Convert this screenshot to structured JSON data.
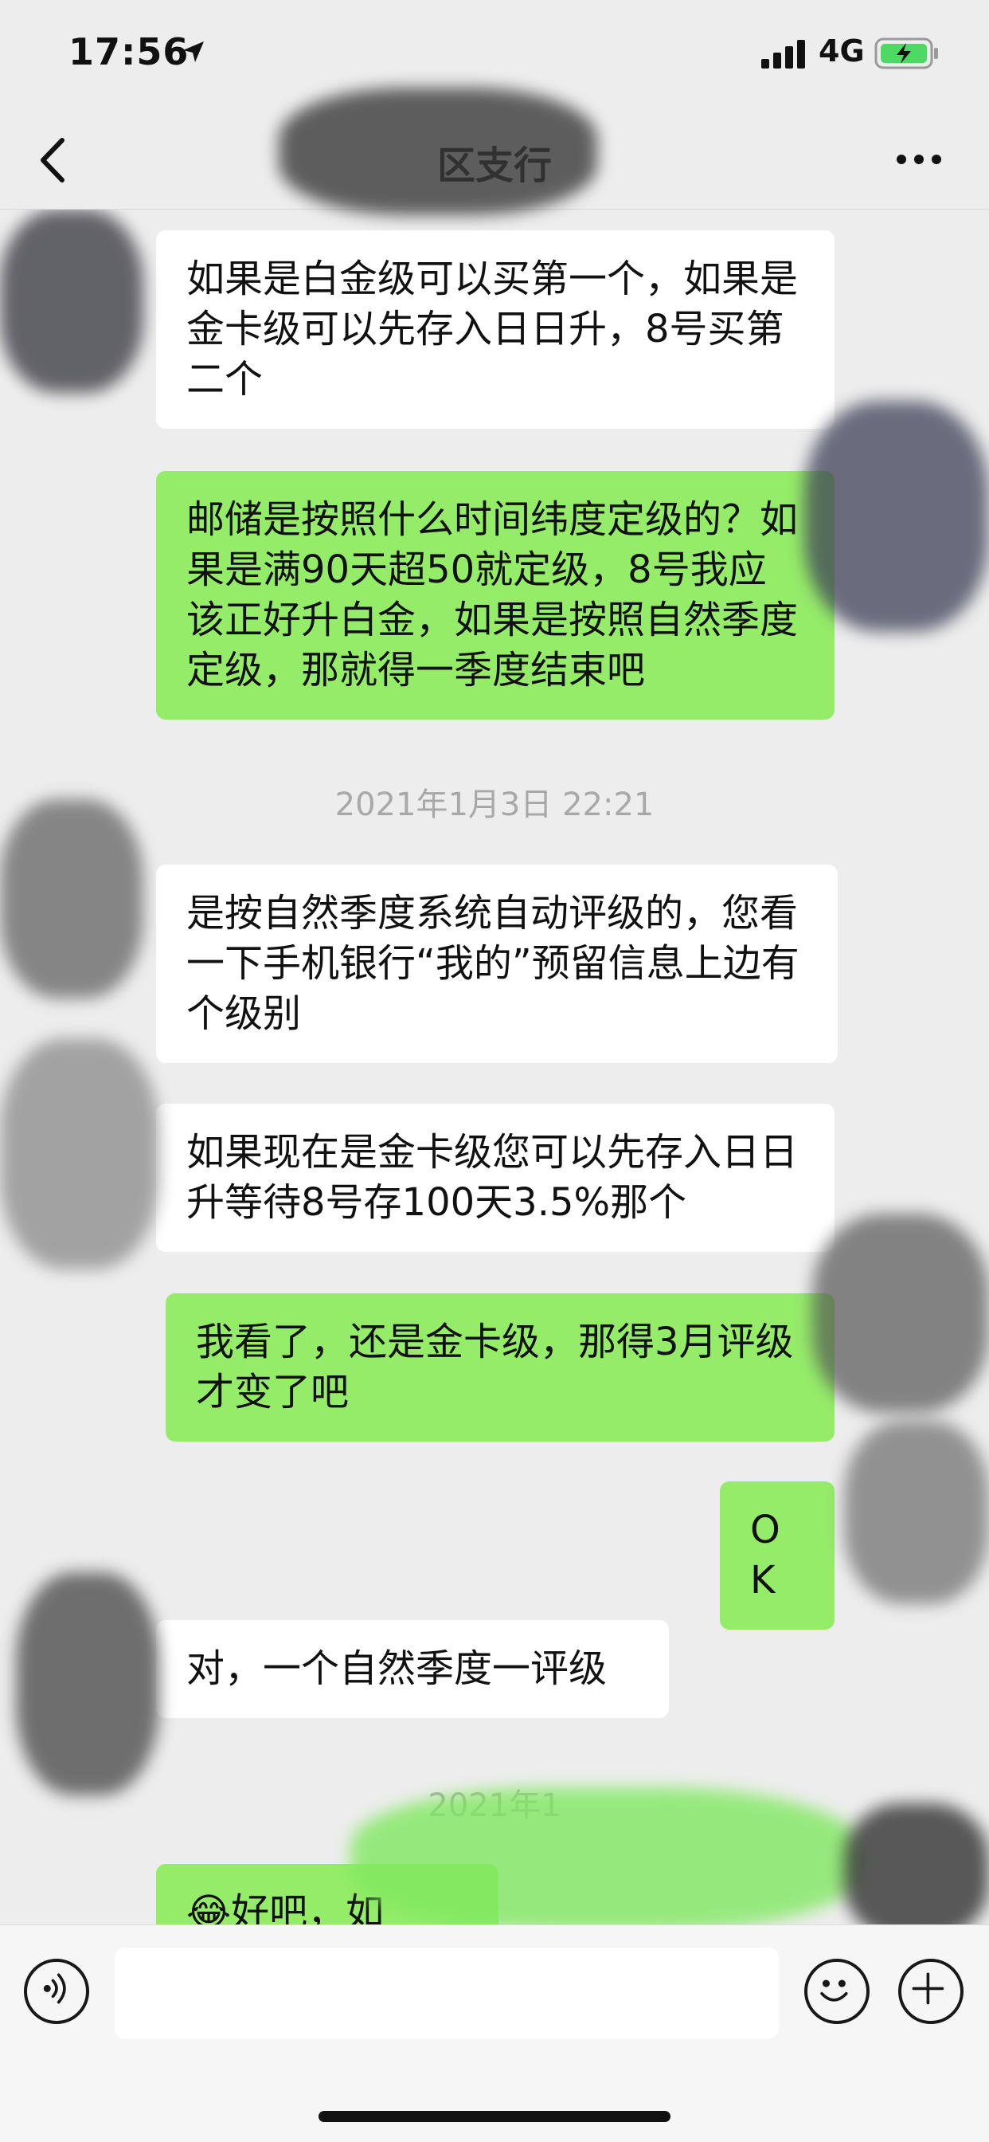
{
  "status_bar": {
    "time": "17:56",
    "network": "4G",
    "battery_charging": true
  },
  "nav": {
    "title": "区支行"
  },
  "messages": [
    {
      "side": "in",
      "text": "如果是白金级可以买第一个，如果是金卡级可以先存入日日升，8号买第二个"
    },
    {
      "side": "out",
      "text": "邮储是按照什么时间纬度定级的？如果是满90天超50就定级，8号我应该正好升白金，如果是按照自然季度定级，那就得一季度结束吧"
    },
    {
      "side": "in",
      "text": "是按自然季度系统自动评级的，您看一下手机银行“我的”预留信息上边有个级别"
    },
    {
      "side": "in",
      "text": "如果现在是金卡级您可以先存入日日升等待8号存100天3.5%那个"
    },
    {
      "side": "out",
      "text": "我看了，还是金卡级，那得3月评级才变了吧"
    },
    {
      "side": "out",
      "text": "OK"
    },
    {
      "side": "in",
      "text": "对，一个自然季度一评级"
    },
    {
      "side": "in",
      "text": "😂好吧，如"
    }
  ],
  "timestamps": [
    "2021年1月3日 22:21",
    "2021年1"
  ],
  "input": {
    "placeholder": ""
  },
  "colors": {
    "background": "#ededed",
    "incoming_bubble": "#ffffff",
    "outgoing_bubble": "#95ec69"
  }
}
